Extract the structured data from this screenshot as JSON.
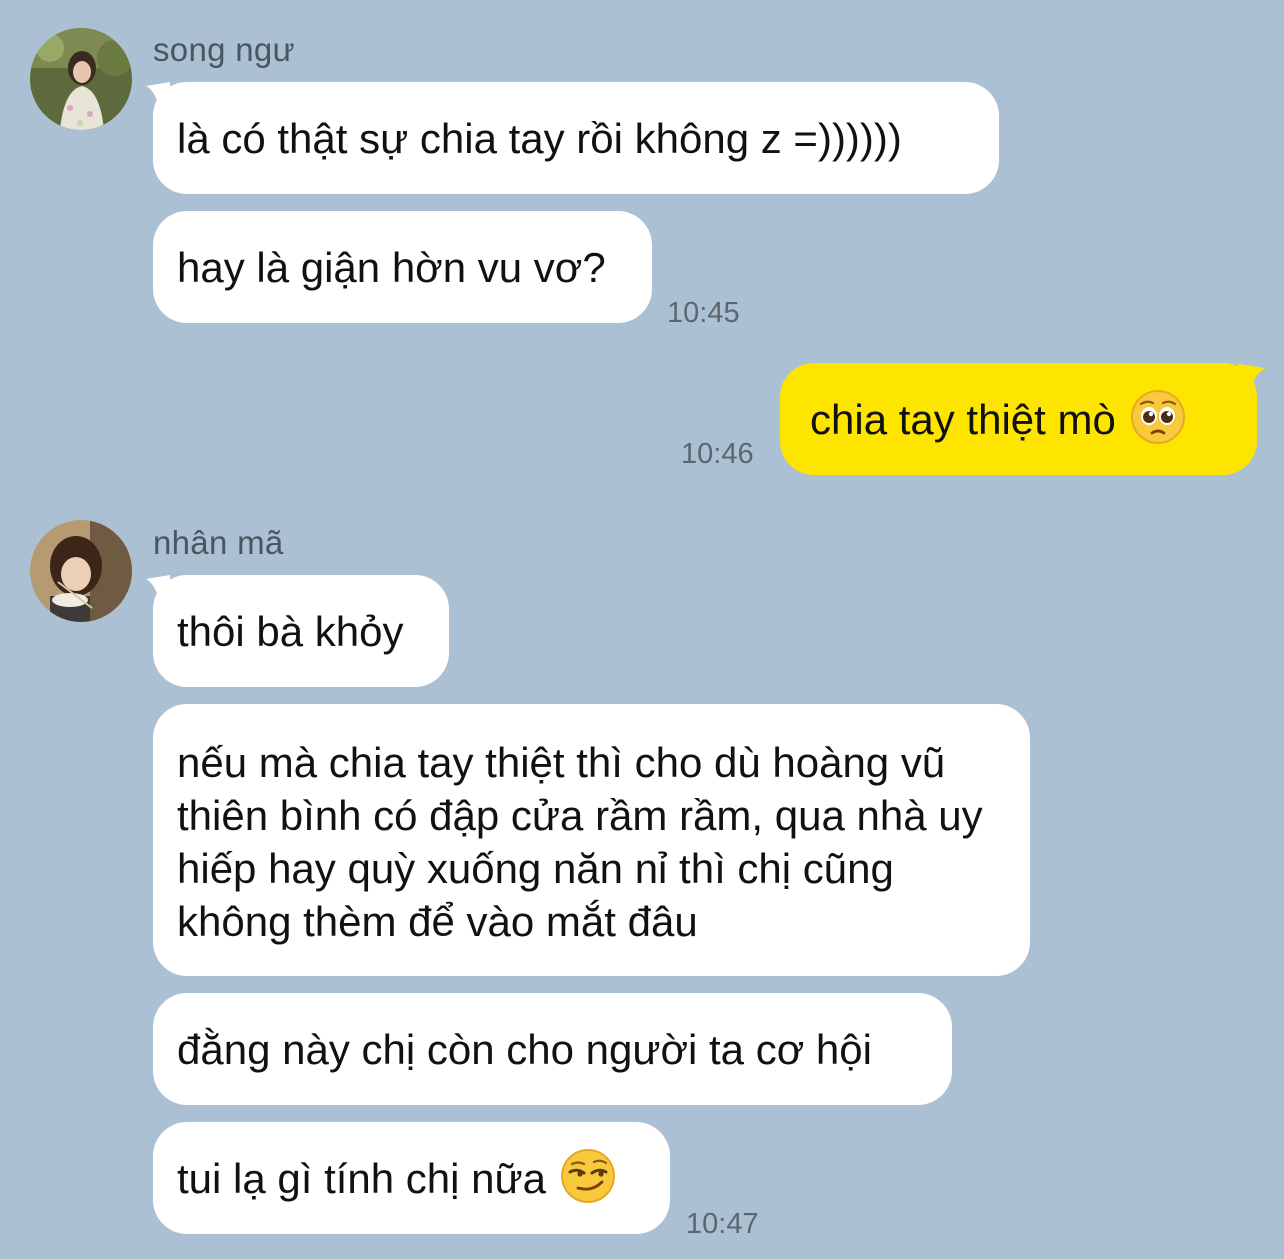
{
  "colors": {
    "background": "#abc1d3",
    "incoming_bubble": "#ffffff",
    "outgoing_bubble": "#fee500",
    "timestamp": "#5b6670"
  },
  "group1": {
    "sender": "song ngư",
    "avatar": "avatar-photo",
    "messages": [
      "là có thật sự chia tay rồi không z =))))))",
      "hay là giận hờn vu vơ?"
    ],
    "time": "10:45"
  },
  "mine": {
    "text": "chia tay thiệt mò",
    "emoji": "pleading-face-emoji",
    "time": "10:46"
  },
  "group2": {
    "sender": "nhân mã",
    "avatar": "avatar-photo",
    "messages": [
      "thôi bà khỏy",
      "nếu mà chia tay thiệt thì cho dù hoàng vũ thiên bình có đập cửa rầm rầm, qua nhà uy hiếp hay quỳ xuống năn nỉ thì chị cũng không thèm để vào mắt đâu",
      "đằng này chị còn cho người ta cơ hội",
      "tui lạ gì tính chị nữa"
    ],
    "last_emoji": "smirking-face-emoji",
    "time": "10:47"
  }
}
